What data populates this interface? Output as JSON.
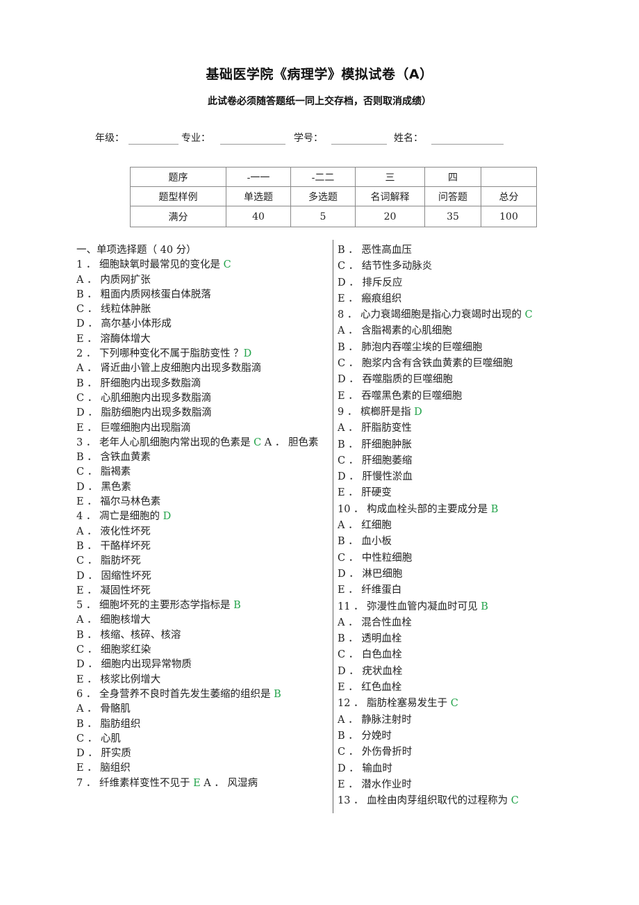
{
  "header": {
    "title": "基础医学院《病理学》模拟试卷（A）",
    "subtitle": "此试卷必须随答题纸一同上交存档，否则取消成绩）"
  },
  "info": {
    "grade_label": "年级：",
    "major_label": "专业：",
    "student_id_label": "学号：",
    "name_label": "姓名："
  },
  "score_table": {
    "rows": [
      [
        "题序",
        "-一一",
        "-二二",
        "三",
        "四",
        ""
      ],
      [
        "题型样例",
        "单选题",
        "多选题",
        "名词解释",
        "问答题",
        "总分"
      ],
      [
        "满分",
        "40",
        "5",
        "20",
        "35",
        "100"
      ]
    ]
  },
  "left_column": [
    {
      "text": "一、单项选择题（ 40 分）",
      "answer": ""
    },
    {
      "text": "1 ． 细胞缺氧时最常见的变化是 ",
      "answer": "C"
    },
    {
      "text": "A ． 内质网扩张",
      "answer": ""
    },
    {
      "text": "B ． 粗面内质网核蛋白体脱落",
      "answer": ""
    },
    {
      "text": "C ． 线粒体肿胀",
      "answer": ""
    },
    {
      "text": "D ． 高尔基小体形成",
      "answer": ""
    },
    {
      "text": "E ． 溶酶体增大",
      "answer": ""
    },
    {
      "text": "2 ． 下列哪种变化不属于脂肪变性 ？",
      "answer": "D"
    },
    {
      "text": "A ． 肾近曲小管上皮细胞内出现多数脂滴",
      "answer": ""
    },
    {
      "text": "B ． 肝细胞内出现多数脂滴",
      "answer": ""
    },
    {
      "text": "C ． 心肌细胞内出现多数脂滴",
      "answer": ""
    },
    {
      "text": "D ． 脂肪细胞内出现多数脂滴",
      "answer": ""
    },
    {
      "text": "E ． 巨噬细胞内出现脂滴",
      "answer": ""
    },
    {
      "text": "3 ． 老年人心肌细胞内常出现的色素是 ",
      "answer": "C",
      "after": " A ． 胆色素"
    },
    {
      "text": "B ． 含铁血黄素",
      "answer": ""
    },
    {
      "text": "C ． 脂褐素",
      "answer": ""
    },
    {
      "text": "D ． 黑色素",
      "answer": ""
    },
    {
      "text": "E ． 福尔马林色素",
      "answer": ""
    },
    {
      "text": "4 ． 凋亡是细胞的 ",
      "answer": "D"
    },
    {
      "text": "A ． 液化性坏死",
      "answer": ""
    },
    {
      "text": "B ． 干酪样坏死",
      "answer": ""
    },
    {
      "text": "C ． 脂肪坏死",
      "answer": ""
    },
    {
      "text": "D ． 固缩性坏死",
      "answer": ""
    },
    {
      "text": "E ． 凝固性坏死",
      "answer": ""
    },
    {
      "text": "5 ． 细胞坏死的主要形态学指标是 ",
      "answer": "B"
    },
    {
      "text": "A ． 细胞核增大",
      "answer": ""
    },
    {
      "text": "B ． 核缩、核碎、核溶",
      "answer": ""
    },
    {
      "text": "C ． 细胞浆红染",
      "answer": ""
    },
    {
      "text": "D ． 细胞内出现异常物质",
      "answer": ""
    },
    {
      "text": "E ． 核浆比例增大",
      "answer": ""
    },
    {
      "text": "6 ． 全身营养不良时首先发生萎缩的组织是 ",
      "answer": "B"
    },
    {
      "text": "A ． 骨骼肌",
      "answer": ""
    },
    {
      "text": "B ． 脂肪组织",
      "answer": ""
    },
    {
      "text": "C ． 心肌",
      "answer": ""
    },
    {
      "text": "D ． 肝实质",
      "answer": ""
    },
    {
      "text": "E ． 脑组织",
      "answer": ""
    },
    {
      "text": "7 ． 纤维素样变性不见于 ",
      "answer": "E",
      "after": " A ． 风湿病"
    }
  ],
  "right_column": [
    {
      "text": "B ． 恶性高血压",
      "answer": ""
    },
    {
      "text": "C ． 结节性多动脉炎",
      "answer": ""
    },
    {
      "text": "D ． 排斥反应",
      "answer": ""
    },
    {
      "text": "E ． 瘢痕组织",
      "answer": ""
    },
    {
      "text": "8 ． 心力衰竭细胞是指心力衰竭时出现的 ",
      "answer": "C"
    },
    {
      "text": "A ． 含脂褐素的心肌细胞",
      "answer": ""
    },
    {
      "text": "B ． 肺泡内吞噬尘埃的巨噬细胞",
      "answer": ""
    },
    {
      "text": "C ． 胞浆内含有含铁血黄素的巨噬细胞",
      "answer": ""
    },
    {
      "text": "D ． 吞噬脂质的巨噬细胞",
      "answer": ""
    },
    {
      "text": "E ． 吞噬黑色素的巨噬细胞",
      "answer": ""
    },
    {
      "text": "9 ． 槟榔肝是指 ",
      "answer": "D"
    },
    {
      "text": "A ． 肝脂肪变性",
      "answer": ""
    },
    {
      "text": "B ． 肝细胞肿胀",
      "answer": ""
    },
    {
      "text": "C ． 肝细胞萎缩",
      "answer": ""
    },
    {
      "text": "D ． 肝慢性淤血",
      "answer": ""
    },
    {
      "text": "E ． 肝硬变",
      "answer": ""
    },
    {
      "text": "10 ． 构成血栓头部的主要成分是 ",
      "answer": "B"
    },
    {
      "text": "A ． 红细胞",
      "answer": ""
    },
    {
      "text": "B ． 血小板",
      "answer": ""
    },
    {
      "text": "C ． 中性粒细胞",
      "answer": ""
    },
    {
      "text": "D ． 淋巴细胞",
      "answer": ""
    },
    {
      "text": "E ． 纤维蛋白",
      "answer": ""
    },
    {
      "text": "11 ． 弥漫性血管内凝血时可见 ",
      "answer": "B"
    },
    {
      "text": "A ． 混合性血栓",
      "answer": ""
    },
    {
      "text": "B ． 透明血栓",
      "answer": ""
    },
    {
      "text": "C ． 白色血栓",
      "answer": ""
    },
    {
      "text": "D ． 疣状血栓",
      "answer": ""
    },
    {
      "text": "E ． 红色血栓",
      "answer": ""
    },
    {
      "text": "12 ． 脂肪栓塞易发生于 ",
      "answer": "C"
    },
    {
      "text": "A ． 静脉注射时",
      "answer": ""
    },
    {
      "text": "B ． 分娩时",
      "answer": ""
    },
    {
      "text": "C ． 外伤骨折时",
      "answer": ""
    },
    {
      "text": "D ． 输血时",
      "answer": ""
    },
    {
      "text": "E ． 潜水作业时",
      "answer": ""
    },
    {
      "text": "13 ． 血栓由肉芽组织取代的过程称为 ",
      "answer": "C"
    }
  ],
  "colors": {
    "answer": "#22a34a",
    "text": "#222222"
  }
}
